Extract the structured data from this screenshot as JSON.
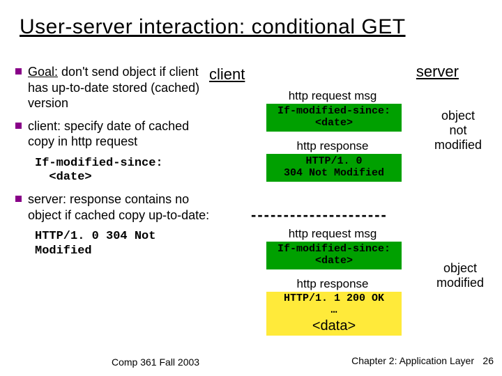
{
  "title": "User-server interaction: conditional GET",
  "columns": {
    "client": "client",
    "server": "server"
  },
  "bullets": {
    "b1_prefix": "Goal:",
    "b1_rest": " don't send object if client has up-to-date stored (cached) version",
    "b2": "client: specify date of cached copy in http request",
    "b2_code": "If-modified-since:\n  <date>",
    "b3": "server: response contains no object if cached copy up-to-date:",
    "b3_code": "HTTP/1. 0 304 Not\nModified"
  },
  "exchange1": {
    "req_label": "http request msg",
    "req_code": "If-modified-since:\n<date>",
    "resp_label": "http response",
    "resp_code": "HTTP/1. 0\n304 Not Modified",
    "note": "object\nnot\nmodified"
  },
  "exchange2": {
    "req_label": "http request msg",
    "req_code": "If-modified-since:\n<date>",
    "resp_label": "http response",
    "resp_code1": "HTTP/1. 1 200 OK\n…",
    "resp_code2": "<data>",
    "note": "object\nmodified"
  },
  "footer": {
    "left": "Comp 361   Fall 2003",
    "right": "Chapter 2: Application Layer",
    "num": "26"
  }
}
